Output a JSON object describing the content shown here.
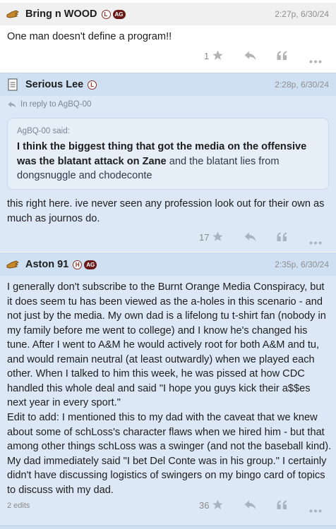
{
  "posts": [
    {
      "username": "Bring n WOOD",
      "badges": [
        "L",
        "AG"
      ],
      "timestamp": "2:27p, 6/30/24",
      "body": "One man doesn't define a program!!",
      "likes": "1"
    },
    {
      "username": "Serious Lee",
      "badges": [
        "L"
      ],
      "timestamp": "2:28p, 6/30/24",
      "reply_to": "In reply to AgBQ-00",
      "quote_author": "AgBQ-00 said:",
      "quote_bold": "I think the biggest thing that got the media on the offensive was the blatant attack on Zane",
      "quote_rest": " and the blatant lies from dongsnuggle and chodeconte",
      "body": "this right here. ive never seen any profession look out for their own as much as journos do.",
      "likes": "17"
    },
    {
      "username": "Aston 91",
      "badges": [
        "H",
        "AG"
      ],
      "timestamp": "2:35p, 6/30/24",
      "body_p1": "I generally don't subscribe to the Burnt Orange Media Conspiracy, but it does seem tu has been viewed as the a-holes in this scenario - and not just by the media. My own dad is a lifelong tu t-shirt fan (nobody in my family before me went to college) and I know he's changed his tune. After I went to A&M he would actively root for both A&M and tu, and would remain neutral (at least outwardly) when we played each other. When I talked to him this week, he was pissed at how CDC handled this whole deal and said \"I hope you guys kick their a$$es next year in every sport.\"",
      "body_p2": "Edit to add: I mentioned this to my dad with the caveat that we knew about some of schLoss's character flaws when we hired him - but that among other things schLoss was a swinger (and not the baseball kind). My dad immediately said \"I bet Del Conte was in his group.\" I certainly didn't have discussing logistics of swingers on my bingo card of topics to discuss with my dad.",
      "edits": "2 edits",
      "likes": "36"
    }
  ],
  "icons": {
    "like": "star-icon",
    "reply": "reply-arrow-icon",
    "quote": "quote-icon",
    "more": "more-dots-icon",
    "avatar_user": "hand-avatar-icon",
    "avatar_document": "document-avatar-icon"
  },
  "colors": {
    "header_bg": "#f0f0f0",
    "highlight_bg": "#dde8f6",
    "highlight_header_bg": "#cfe0f3",
    "badge_ag": "#6b1818",
    "badge_outline": "#8a2a20"
  }
}
